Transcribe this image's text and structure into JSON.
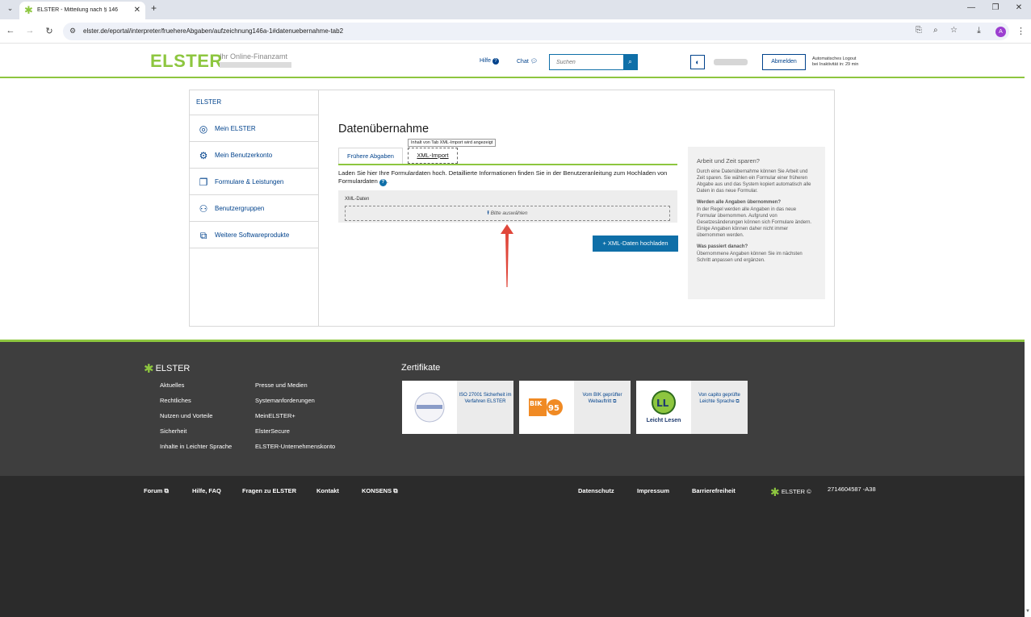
{
  "browser": {
    "tab_title": "ELSTER - Mitteilung nach § 146",
    "url": "elster.de/eportal/interpreter/fruehereAbgaben/aufzeichnung146a-1#datenuebernahme-tab2",
    "profile_initial": "A"
  },
  "header": {
    "logo": "ELSTER",
    "logo_sub": "Ihr Online-Finanzamt",
    "help": "Hilfe",
    "chat": "Chat",
    "search_placeholder": "Suchen",
    "logout": "Abmelden",
    "auto_logout_line1": "Automatisches Logout",
    "auto_logout_line2": "bei Inaktivität in: 29 min"
  },
  "sidebar": {
    "head": "ELSTER",
    "items": [
      {
        "label": "Mein ELSTER",
        "icon": "user-circle-icon"
      },
      {
        "label": "Mein Benutzerkonto",
        "icon": "gear-icon"
      },
      {
        "label": "Formulare & Leistungen",
        "icon": "documents-icon"
      },
      {
        "label": "Benutzergruppen",
        "icon": "group-icon"
      },
      {
        "label": "Weitere Softwareprodukte",
        "icon": "external-window-icon"
      }
    ]
  },
  "main": {
    "title": "Datenübernahme",
    "tooltip": "Inhalt von Tab XML-Import wird angezeigt",
    "tabs": [
      "Frühere Abgaben",
      "XML-Import"
    ],
    "desc": "Laden Sie hier Ihre Formulardaten hoch. Detaillierte Informationen finden Sie in der Benutzeranleitung zum Hochladen von Formulardaten",
    "upload_label": "XML-Daten",
    "file_pick": "Bitte auswählen",
    "upload_button": "+ XML-Daten hochladen"
  },
  "info": {
    "title": "Arbeit und Zeit sparen?",
    "p1": "Durch eine Datenübernahme können Sie Arbeit und Zeit sparen. Sie wählen ein Formular einer früheren Abgabe aus und das System kopiert automatisch alle Daten in das neue Formular.",
    "h2": "Werden alle Angaben übernommen?",
    "p2": "In der Regel werden alle Angaben in das neue Formular übernommen. Aufgrund von Gesetzesänderungen können sich Formulare ändern. Einige Angaben können daher nicht immer übernommen werden.",
    "h3": "Was passiert danach?",
    "p3": "Übernommene Angaben können Sie im nächsten Schritt anpassen und ergänzen."
  },
  "footer": {
    "logo": "ELSTER",
    "col1": [
      "Aktuelles",
      "Rechtliches",
      "Nutzen und Vorteile",
      "Sicherheit",
      "Inhalte in Leichter Sprache"
    ],
    "col2": [
      "Presse und Medien",
      "Systemanforderungen",
      "MeinELSTER+",
      "ElsterSecure",
      "ELSTER-Unternehmenskonto"
    ],
    "cert_title": "Zertifikate",
    "certs": [
      {
        "text": "ISO 27001 Sicherheit im Verfahren ELSTER"
      },
      {
        "text": "Vom BIK geprüfter Webauftritt"
      },
      {
        "text": "Von capito geprüfte Leichte Sprache",
        "logo_text": "Leicht Lesen"
      }
    ],
    "bottom_links": [
      "Forum",
      "Hilfe, FAQ",
      "Fragen zu ELSTER",
      "Kontakt",
      "KONSENS",
      "Datenschutz",
      "Impressum",
      "Barrierefreiheit"
    ],
    "copyright": "ELSTER ©",
    "version": "2714604587 -A38"
  }
}
